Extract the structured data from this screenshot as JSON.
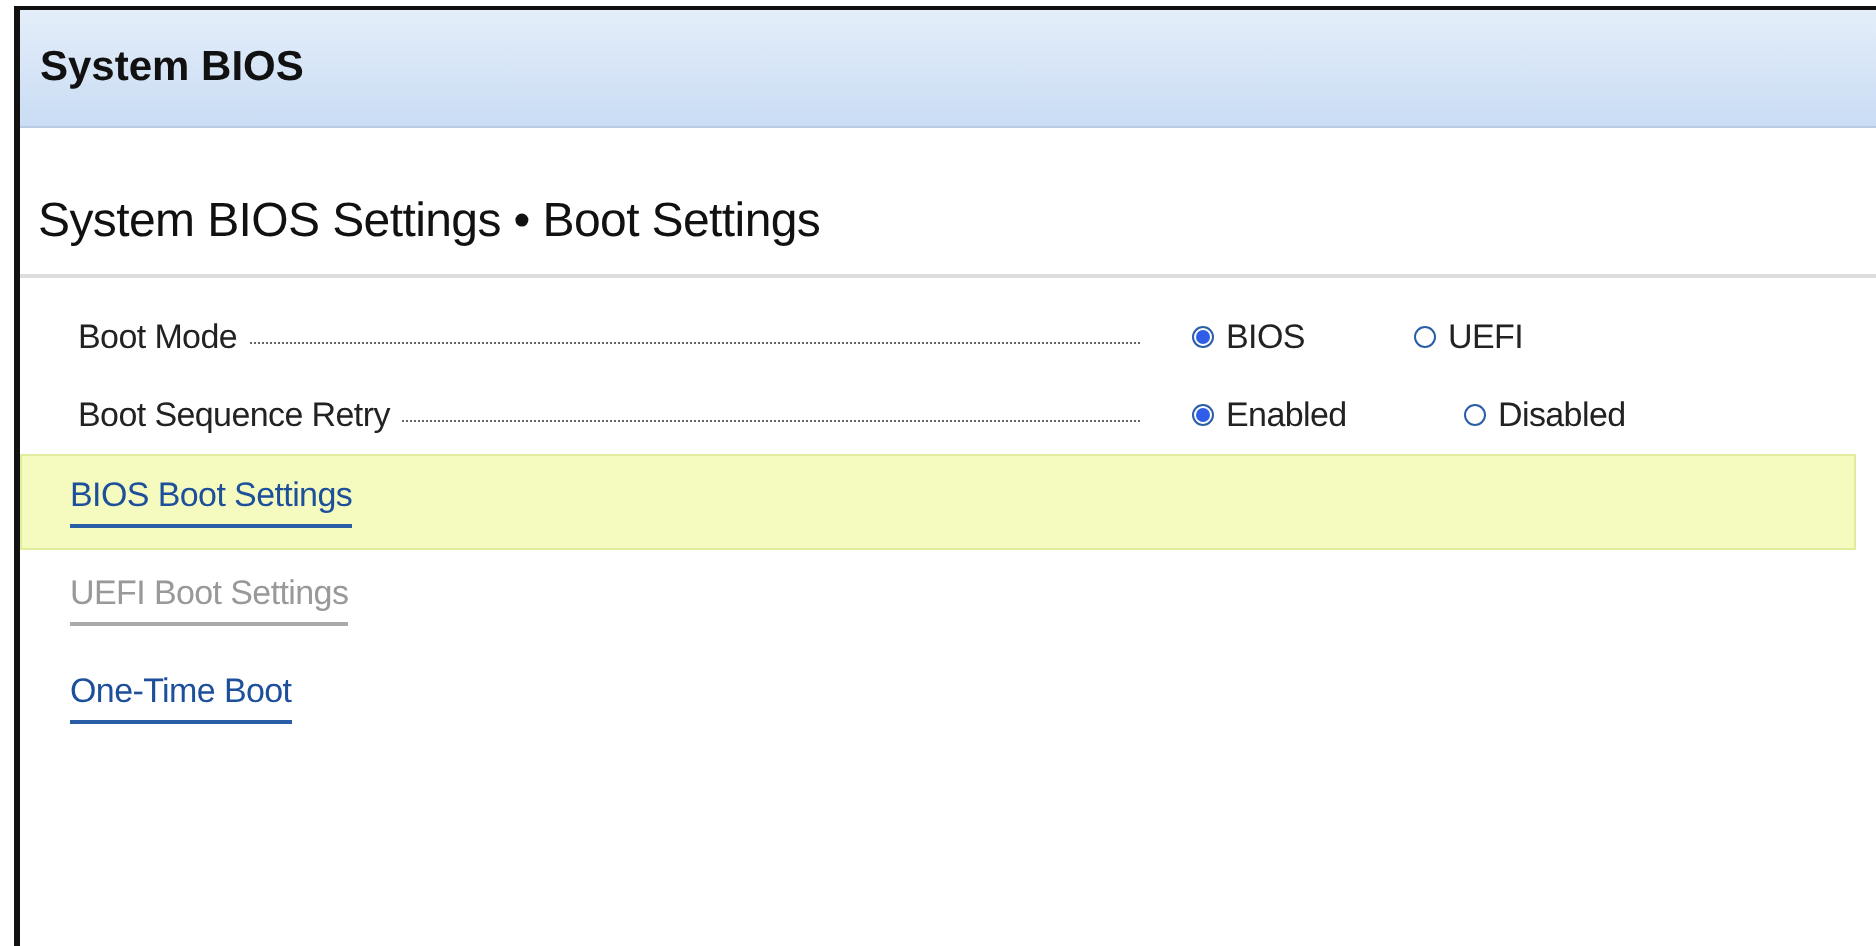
{
  "window": {
    "title": "System BIOS"
  },
  "page": {
    "title": "System BIOS Settings • Boot Settings"
  },
  "settings": [
    {
      "label": "Boot Mode",
      "options": [
        {
          "label": "BIOS",
          "selected": true
        },
        {
          "label": "UEFI",
          "selected": false
        }
      ]
    },
    {
      "label": "Boot Sequence Retry",
      "options": [
        {
          "label": "Enabled",
          "selected": true
        },
        {
          "label": "Disabled",
          "selected": false
        }
      ]
    }
  ],
  "links": [
    {
      "label": "BIOS Boot Settings",
      "selected": true,
      "disabled": false
    },
    {
      "label": "UEFI Boot Settings",
      "selected": false,
      "disabled": true
    },
    {
      "label": "One-Time Boot",
      "selected": false,
      "disabled": false
    }
  ]
}
